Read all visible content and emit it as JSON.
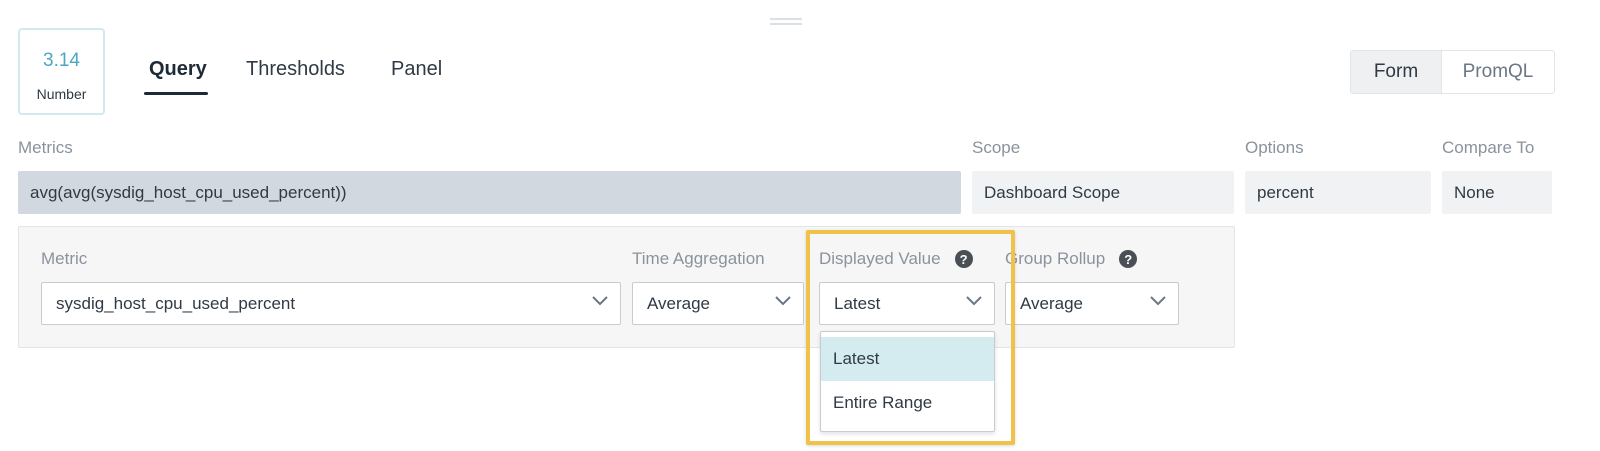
{
  "visualization": {
    "value": "3.14",
    "label": "Number"
  },
  "tabs": [
    {
      "label": "Query",
      "active": true
    },
    {
      "label": "Thresholds",
      "active": false
    },
    {
      "label": "Panel",
      "active": false
    }
  ],
  "mode_toggle": {
    "form": "Form",
    "promql": "PromQL",
    "selected": "Form"
  },
  "columns": {
    "metrics": {
      "label": "Metrics",
      "value": "avg(avg(sysdig_host_cpu_used_percent))"
    },
    "scope": {
      "label": "Scope",
      "value": "Dashboard Scope"
    },
    "options": {
      "label": "Options",
      "value": "percent"
    },
    "compare": {
      "label": "Compare To",
      "value": "None"
    }
  },
  "metric_config": {
    "metric": {
      "label": "Metric",
      "value": "sysdig_host_cpu_used_percent"
    },
    "time_aggregation": {
      "label": "Time Aggregation",
      "value": "Average"
    },
    "displayed_value": {
      "label": "Displayed Value",
      "value": "Latest",
      "options": [
        "Latest",
        "Entire Range"
      ]
    },
    "group_rollup": {
      "label": "Group Rollup",
      "value": "Average"
    }
  },
  "icons": {
    "help": "help-circle-icon",
    "chevron": "chevron-down-icon",
    "drag": "drag-handle-icon"
  },
  "colors": {
    "accent": "#4aa8c3",
    "highlight": "#f0c24b",
    "selected_option": "#d4ebf0"
  }
}
